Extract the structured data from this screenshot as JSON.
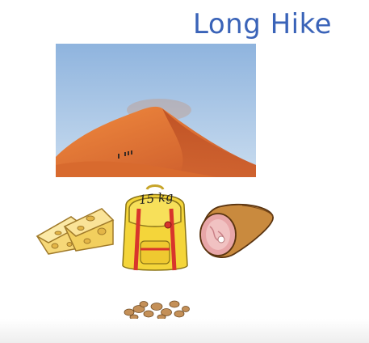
{
  "slide": {
    "title": "Long Hike",
    "backpack_label": "15 kg"
  },
  "icons": {
    "photo": "desert-dune-photo",
    "cheese": "cheese-icon",
    "backpack": "backpack-icon",
    "ham": "ham-icon",
    "nuts": "nuts-icon"
  },
  "colors": {
    "title": "#3a63b8",
    "backpack": "#f4d53a",
    "strap": "#d8342c",
    "sand": "#e07a3a",
    "sky": "#a9c6e6"
  }
}
